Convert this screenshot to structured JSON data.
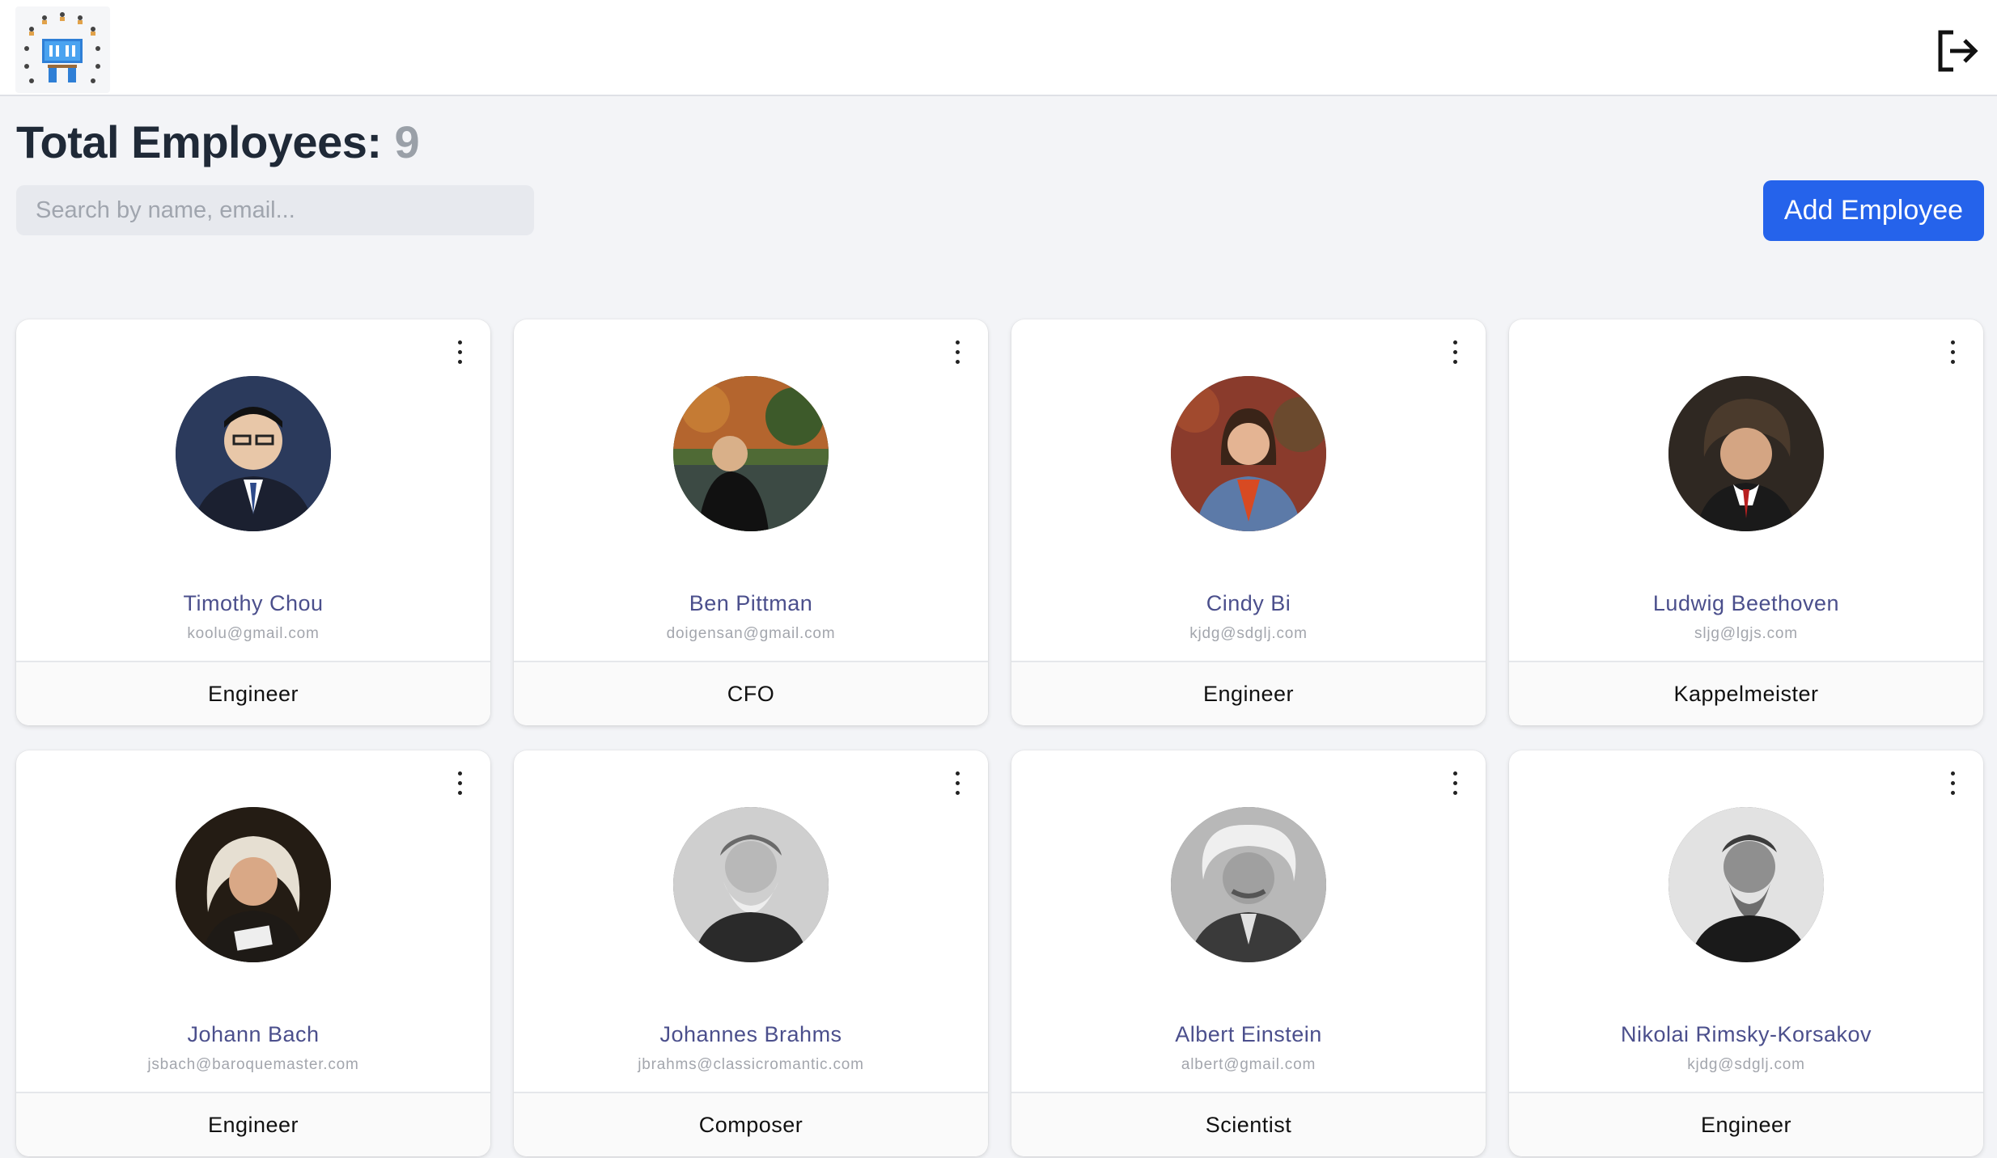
{
  "header": {
    "logo_icon": "team-workstation-logo",
    "logout_icon": "logout-icon"
  },
  "summary": {
    "title_label": "Total Employees:",
    "count": "9"
  },
  "search": {
    "placeholder": "Search by name, email...",
    "value": ""
  },
  "actions": {
    "add_label": "Add Employee",
    "add_color": "#2563eb"
  },
  "employees": [
    {
      "name": "Timothy Chou",
      "email": "koolu@gmail.com",
      "role": "Engineer",
      "avatar_bg": "#2b3550"
    },
    {
      "name": "Ben Pittman",
      "email": "doigensan@gmail.com",
      "role": "CFO",
      "avatar_bg": "#5b6b3a"
    },
    {
      "name": "Cindy Bi",
      "email": "kjdg@sdglj.com",
      "role": "Engineer",
      "avatar_bg": "#9b4a32"
    },
    {
      "name": "Ludwig Beethoven",
      "email": "sljg@lgjs.com",
      "role": "Kappelmeister",
      "avatar_bg": "#3a2e26"
    },
    {
      "name": "Johann Bach",
      "email": "jsbach@baroquemaster.com",
      "role": "Engineer",
      "avatar_bg": "#2a2218"
    },
    {
      "name": "Johannes Brahms",
      "email": "jbrahms@classicromantic.com",
      "role": "Composer",
      "avatar_bg": "#9a9a9a"
    },
    {
      "name": "Albert Einstein",
      "email": "albert@gmail.com",
      "role": "Scientist",
      "avatar_bg": "#8f8f8f"
    },
    {
      "name": "Nikolai Rimsky-Korsakov",
      "email": "kjdg@sdglj.com",
      "role": "Engineer",
      "avatar_bg": "#6e6e6e"
    }
  ],
  "colors": {
    "name_text": "#4b4f8c",
    "email_text": "#a3a6ad",
    "page_bg": "#f3f4f7"
  }
}
